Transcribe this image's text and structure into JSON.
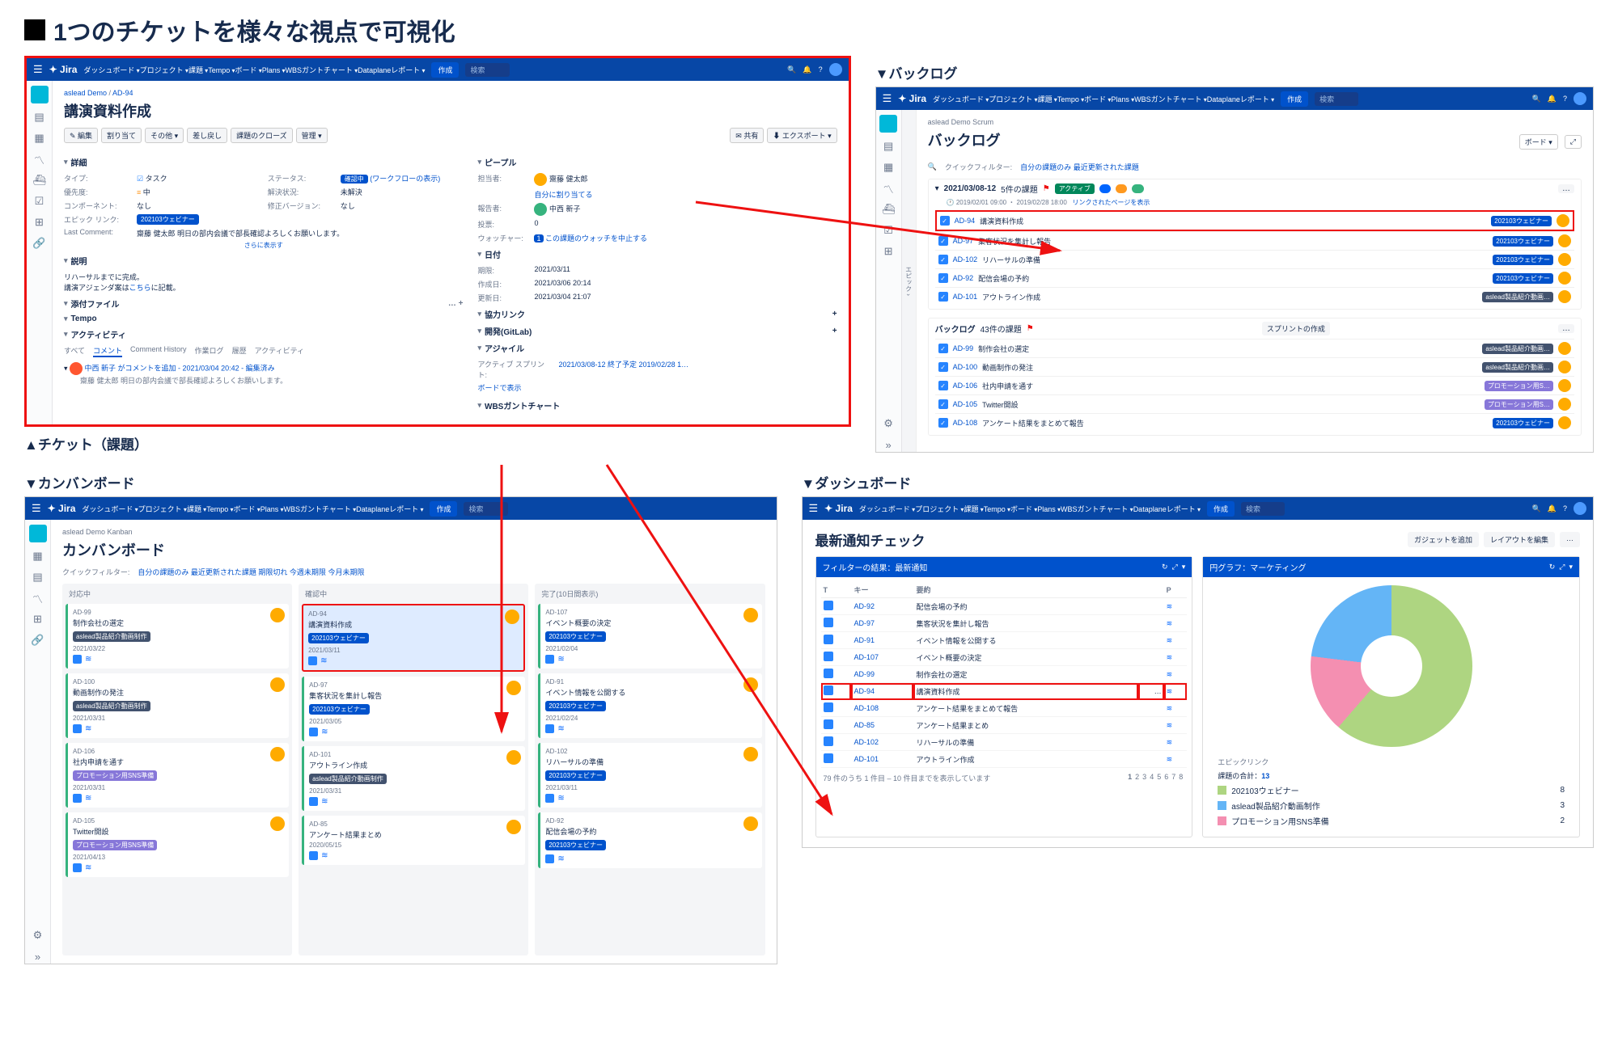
{
  "main_title": "1つのチケットを様々な視点で可視化",
  "labels": {
    "ticket": "▲チケット（課題）",
    "backlog": "▼バックログ",
    "kanban": "▼カンバンボード",
    "dashboard": "▼ダッシュボード"
  },
  "nav": {
    "items": [
      "ダッシュボード",
      "プロジェクト",
      "課題",
      "Tempo",
      "ボード",
      "Plans",
      "WBSガントチャート",
      "Dataplaneレポート"
    ],
    "create": "作成",
    "search": "検索"
  },
  "ticket": {
    "breadcrumb_proj": "aslead Demo",
    "breadcrumb_key": "AD-94",
    "title": "講演資料作成",
    "toolbar": [
      "編集",
      "割り当て",
      "その他",
      "差し戻し",
      "課題のクローズ",
      "管理"
    ],
    "share": "共有",
    "export": "エクスポート",
    "sec_detail": "詳細",
    "sec_comment": "コメント",
    "fields": {
      "type_l": "タイプ:",
      "type_v": "タスク",
      "status_l": "ステータス:",
      "status_v": "確認中",
      "status_hint": "(ワークフローの表示)",
      "prio_l": "優先度:",
      "prio_v": "中",
      "res_l": "解決状況:",
      "res_v": "未解決",
      "comp_l": "コンポーネント:",
      "comp_v": "なし",
      "ver_l": "修正バージョン:",
      "ver_v": "なし",
      "epic_l": "エピック リンク:",
      "epic_v": "202103ウェビナー",
      "lc_l": "Last Comment:",
      "lc_v": "齋藤 健太郎 明日の部内会議で部長確認よろしくお願いします。"
    },
    "more_fields": "さらに表示す",
    "sec_desc": "説明",
    "desc1": "リハーサルまでに完成。",
    "desc2_a": "講演アジェンダ案は",
    "desc2_link": "こちら",
    "desc2_b": "に記載。",
    "sec_attach": "添付ファイル",
    "sec_tempo": "Tempo",
    "sec_activity": "アクティビティ",
    "act_tabs": [
      "すべて",
      "コメント",
      "Comment History",
      "作業ログ",
      "履歴",
      "アクティビティ"
    ],
    "act_line": "中西 新子 がコメントを追加 - 2021/03/04 20:42 - 編集済み",
    "act_line2": "齋藤 健太郎 明日の部内会議で部長確認よろしくお願いします。",
    "sec_people": "ピープル",
    "assignee_l": "担当者:",
    "assignee_v": "齋藤 健太郎",
    "assign_me": "自分に割り当てる",
    "reporter_l": "報告者:",
    "reporter_v": "中西 新子",
    "votes_l": "投票:",
    "votes_v": "0",
    "watch_l": "ウォッチャー:",
    "watch_v": "1",
    "watch_link": "この課題のウォッチを中止する",
    "sec_dates": "日付",
    "due_l": "期限:",
    "due_v": "2021/03/11",
    "created_l": "作成日:",
    "created_v": "2021/03/06 20:14",
    "updated_l": "更新日:",
    "updated_v": "2021/03/04 21:07",
    "sec_links": "協力リンク",
    "sec_dev": "開発(GitLab)",
    "sec_agile": "アジャイル",
    "agile_sprint_l": "アクティブ スプリント:",
    "agile_sprint_v": "2021/03/08-12 終了予定 2019/02/28 1…",
    "agile_board": "ボードで表示",
    "sec_wbs": "WBSガントチャート"
  },
  "backlog": {
    "project": "aslead Demo Scrum",
    "title": "バックログ",
    "board_btn": "ボード",
    "qf_label": "クイックフィルター:",
    "qf": [
      "自分の課題のみ",
      "最近更新された課題"
    ],
    "sprint_name": "2021/03/08-12",
    "sprint_count": "5件の課題",
    "active": "アクティブ",
    "dates": "2019/02/01 09:00 ・ 2019/02/28 18:00",
    "linked_pages": "リンクされたページを表示",
    "rows": [
      {
        "key": "AD-94",
        "summ": "講演資料作成",
        "epic": "202103ウェビナー",
        "epic_c": "#0052cc",
        "hl": true
      },
      {
        "key": "AD-97",
        "summ": "集客状況を集計し報告",
        "epic": "202103ウェビナー",
        "epic_c": "#0052cc"
      },
      {
        "key": "AD-102",
        "summ": "リハーサルの準備",
        "epic": "202103ウェビナー",
        "epic_c": "#0052cc"
      },
      {
        "key": "AD-92",
        "summ": "配信会場の予約",
        "epic": "202103ウェビナー",
        "epic_c": "#0052cc"
      },
      {
        "key": "AD-101",
        "summ": "アウトライン作成",
        "epic": "aslead製品紹介動画…",
        "epic_c": "#42526e"
      }
    ],
    "bl_label": "バックログ",
    "bl_count": "43件の課題",
    "create_sprint": "スプリントの作成",
    "bl_rows": [
      {
        "key": "AD-99",
        "summ": "制作会社の選定",
        "epic": "aslead製品紹介動画…",
        "epic_c": "#42526e"
      },
      {
        "key": "AD-100",
        "summ": "動画制作の発注",
        "epic": "aslead製品紹介動画…",
        "epic_c": "#42526e"
      },
      {
        "key": "AD-106",
        "summ": "社内申請を通す",
        "epic": "プロモーション用S…",
        "epic_c": "#8777d9"
      },
      {
        "key": "AD-105",
        "summ": "Twitter開設",
        "epic": "プロモーション用S…",
        "epic_c": "#8777d9"
      },
      {
        "key": "AD-108",
        "summ": "アンケート結果をまとめて報告",
        "epic": "202103ウェビナー",
        "epic_c": "#0052cc"
      }
    ]
  },
  "kanban": {
    "project": "aslead Demo Kanban",
    "title": "カンバンボード",
    "qf_label": "クイックフィルター:",
    "qf": [
      "自分の課題のみ",
      "最近更新された課題",
      "期限切れ",
      "今週未期限",
      "今月未期限"
    ],
    "cols": [
      "対応中",
      "確認中",
      "完了(10日間表示)"
    ],
    "c1": [
      {
        "key": "AD-99",
        "ttl": "制作会社の選定",
        "tag": "aslead製品紹介動画制作",
        "tag_c": "#42526e",
        "date": "2021/03/22"
      },
      {
        "key": "AD-100",
        "ttl": "動画制作の発注",
        "tag": "aslead製品紹介動画制作",
        "tag_c": "#42526e",
        "date": "2021/03/31"
      },
      {
        "key": "AD-106",
        "ttl": "社内申請を通す",
        "tag": "プロモーション用SNS準備",
        "tag_c": "#8777d9",
        "date": "2021/03/31"
      },
      {
        "key": "AD-105",
        "ttl": "Twitter開設",
        "tag": "プロモーション用SNS準備",
        "tag_c": "#8777d9",
        "date": "2021/04/13"
      }
    ],
    "c2": [
      {
        "key": "AD-94",
        "ttl": "講演資料作成",
        "tag": "202103ウェビナー",
        "tag_c": "#0052cc",
        "date": "2021/03/11",
        "hl": true
      },
      {
        "key": "AD-97",
        "ttl": "集客状況を集計し報告",
        "tag": "202103ウェビナー",
        "tag_c": "#0052cc",
        "date": "2021/03/05"
      },
      {
        "key": "AD-101",
        "ttl": "アウトライン作成",
        "tag": "aslead製品紹介動画制作",
        "tag_c": "#42526e",
        "date": "2021/03/31"
      },
      {
        "key": "AD-85",
        "ttl": "アンケート結果まとめ",
        "tag": "",
        "tag_c": "",
        "date": "2020/05/15"
      }
    ],
    "c3": [
      {
        "key": "AD-107",
        "ttl": "イベント概要の決定",
        "tag": "202103ウェビナー",
        "tag_c": "#0052cc",
        "date": "2021/02/04"
      },
      {
        "key": "AD-91",
        "ttl": "イベント情報を公開する",
        "tag": "202103ウェビナー",
        "tag_c": "#0052cc",
        "date": "2021/02/24"
      },
      {
        "key": "AD-102",
        "ttl": "リハーサルの準備",
        "tag": "202103ウェビナー",
        "tag_c": "#0052cc",
        "date": "2021/03/11"
      },
      {
        "key": "AD-92",
        "ttl": "配信会場の予約",
        "tag": "202103ウェビナー",
        "tag_c": "#0052cc",
        "date": ""
      }
    ]
  },
  "dashboard": {
    "title": "最新通知チェック",
    "add_gadget": "ガジェットを追加",
    "edit_layout": "レイアウトを編集",
    "g1_title": "フィルターの結果：最新通知",
    "table_h": [
      "T",
      "キー",
      "要約",
      "",
      "P"
    ],
    "rows": [
      {
        "key": "AD-92",
        "summ": "配信会場の予約"
      },
      {
        "key": "AD-97",
        "summ": "集客状況を集計し報告"
      },
      {
        "key": "AD-91",
        "summ": "イベント情報を公開する"
      },
      {
        "key": "AD-107",
        "summ": "イベント概要の決定"
      },
      {
        "key": "AD-99",
        "summ": "制作会社の選定"
      },
      {
        "key": "AD-94",
        "summ": "講演資料作成",
        "hl": true
      },
      {
        "key": "AD-108",
        "summ": "アンケート結果をまとめて報告"
      },
      {
        "key": "AD-85",
        "summ": "アンケート結果まとめ"
      },
      {
        "key": "AD-102",
        "summ": "リハーサルの準備"
      },
      {
        "key": "AD-101",
        "summ": "アウトライン作成"
      }
    ],
    "pager_text": "79 件のうち 1 件目 – 10 件目までを表示しています",
    "pages": [
      "1",
      "2",
      "3",
      "4",
      "5",
      "6",
      "7",
      "8"
    ],
    "g2_title": "円グラフ：マーケティング",
    "legend_title": "エピックリンク",
    "total_label": "課題の合計：",
    "total": "13",
    "legend": [
      {
        "label": "202103ウェビナー",
        "val": "8",
        "c": "#aed581"
      },
      {
        "label": "aslead製品紹介動画制作",
        "val": "3",
        "c": "#64b5f6"
      },
      {
        "label": "プロモーション用SNS準備",
        "val": "2",
        "c": "#f48fb1"
      }
    ]
  },
  "chart_data": {
    "type": "pie",
    "title": "円グラフ：マーケティング",
    "categories": [
      "202103ウェビナー",
      "aslead製品紹介動画制作",
      "プロモーション用SNS準備"
    ],
    "values": [
      8,
      3,
      2
    ],
    "total": 13
  }
}
